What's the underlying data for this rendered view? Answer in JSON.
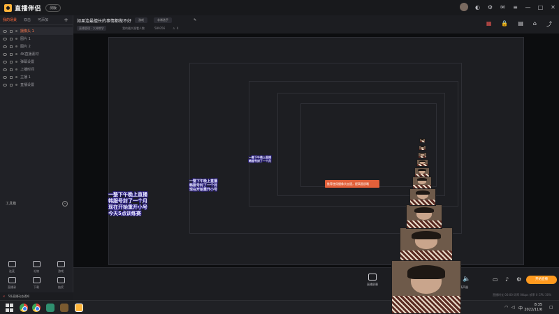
{
  "app": {
    "name": "直播伴侣",
    "version_badge": "测版"
  },
  "scenes": {
    "tabs": [
      "我的场景",
      "双击",
      "可添加"
    ],
    "active_tab": 0,
    "add_label": "+",
    "items": [
      {
        "label": "摄像头 1",
        "active": true,
        "visible": true
      },
      {
        "label": "图片 1",
        "active": false,
        "visible": false
      },
      {
        "label": "图片 2",
        "active": false,
        "visible": false
      },
      {
        "label": "4K直播素材",
        "active": false,
        "visible": false
      },
      {
        "label": "弹幕设置",
        "active": false,
        "visible": false
      },
      {
        "label": "上播时间",
        "active": false,
        "visible": true
      },
      {
        "label": "主播 1",
        "active": false,
        "visible": true
      },
      {
        "label": "直播设置",
        "active": false,
        "visible": false
      }
    ]
  },
  "toolbox": {
    "title": "工具箱",
    "tools": [
      {
        "label": "连麦",
        "icon": "link-icon"
      },
      {
        "label": "礼物",
        "icon": "gift-icon"
      },
      {
        "label": "游戏",
        "icon": "game-icon"
      },
      {
        "label": "直播录",
        "icon": "record-icon"
      },
      {
        "label": "下载",
        "icon": "download-icon"
      },
      {
        "label": "抽奖",
        "icon": "calendar-icon"
      }
    ]
  },
  "room": {
    "title": "如果连最擅长的事情都做不好",
    "edit_label": "✎",
    "tag1": "游戏",
    "tag2": "非常选手",
    "sub_tag": "直播管理 · 大神教学",
    "sub_info": "我的最大观看人数",
    "viewer_count": "589356",
    "likes": "4"
  },
  "caption": {
    "line1": "一整下午晚上直播",
    "line2": "韩服号封了一个月",
    "line3": "现在开始重开小号",
    "line4": "今天5点训练赛"
  },
  "toast": "推荐使用摄像头加速，提高画质哦",
  "controls": {
    "buttons": [
      {
        "label": "直播屏幕",
        "icon": "screen-icon"
      },
      {
        "label": "摄像头",
        "icon": "camera-icon"
      }
    ],
    "volume_label": "扬声器",
    "start_button": "开始直播",
    "stats": "直播时长 00:00  码率 0kbps  帧率 0  CPU 30%"
  },
  "status": {
    "text": "5条直播动态通知"
  },
  "taskbar": {
    "time": "8:35",
    "date": "2022/11/6"
  }
}
